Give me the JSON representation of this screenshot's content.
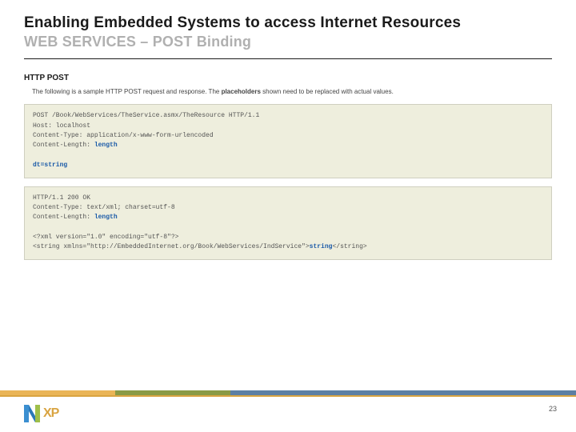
{
  "header": {
    "title_main": "Enabling Embedded Systems to access Internet Resources",
    "title_sub": "WEB SERVICES – POST Binding"
  },
  "section": {
    "label": "HTTP POST",
    "desc_pre": "The following is a sample HTTP POST request and response. The ",
    "desc_bold": "placeholders",
    "desc_post": " shown need to be replaced with actual values."
  },
  "code": {
    "req_line1": "POST /Book/WebServices/TheService.asmx/TheResource HTTP/1.1",
    "req_line2": "Host: localhost",
    "req_line3": "Content-Type: application/x-www-form-urlencoded",
    "req_line4_a": "Content-Length: ",
    "req_line4_hl": "length",
    "req_line5_a": "dt=",
    "req_line5_hl": "string",
    "res_line1": "HTTP/1.1 200 OK",
    "res_line2": "Content-Type: text/xml; charset=utf-8",
    "res_line3_a": "Content-Length: ",
    "res_line3_hl": "length",
    "res_line4": "<?xml version=\"1.0\" encoding=\"utf-8\"?>",
    "res_line5_a": "<string xmlns=\"http://EmbeddedInternet.org/Book/WebServices/IndService\">",
    "res_line5_hl": "string",
    "res_line5_b": "</string>"
  },
  "footer": {
    "page": "23",
    "logo_text": "XP"
  }
}
